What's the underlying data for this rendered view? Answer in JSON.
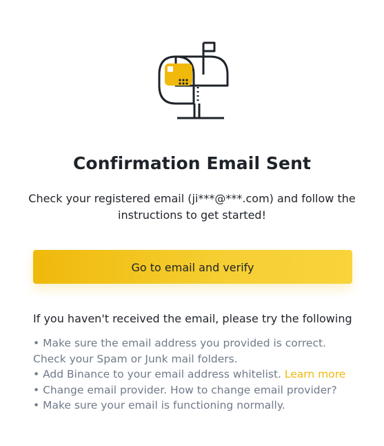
{
  "illustration": {
    "icon": "mailbox-icon",
    "accent_color": "#f0b90b",
    "line_color": "#1e2329"
  },
  "title": "Confirmation Email Sent",
  "subtitle": {
    "line1": "Check your registered email (ji***@***.com) and follow the",
    "line2": "instructions to get started!"
  },
  "verify_button": {
    "label": "Go to email and verify"
  },
  "help": {
    "heading": "If you haven't received the email, please try the following",
    "tips": {
      "line1": "• Make sure the email address you provided is correct.",
      "line2": "Check your Spam or Junk mail folders.",
      "line3": "• Add Binance to your email address whitelist.",
      "learn_more": "Learn more",
      "line4": "• Change email provider.",
      "line4_link": "How to change email provider?",
      "line5": "• Make sure your email is functioning normally."
    }
  },
  "colors": {
    "link": "#f0b90b",
    "muted_text": "#707a8a",
    "primary_text": "#1e2329"
  }
}
